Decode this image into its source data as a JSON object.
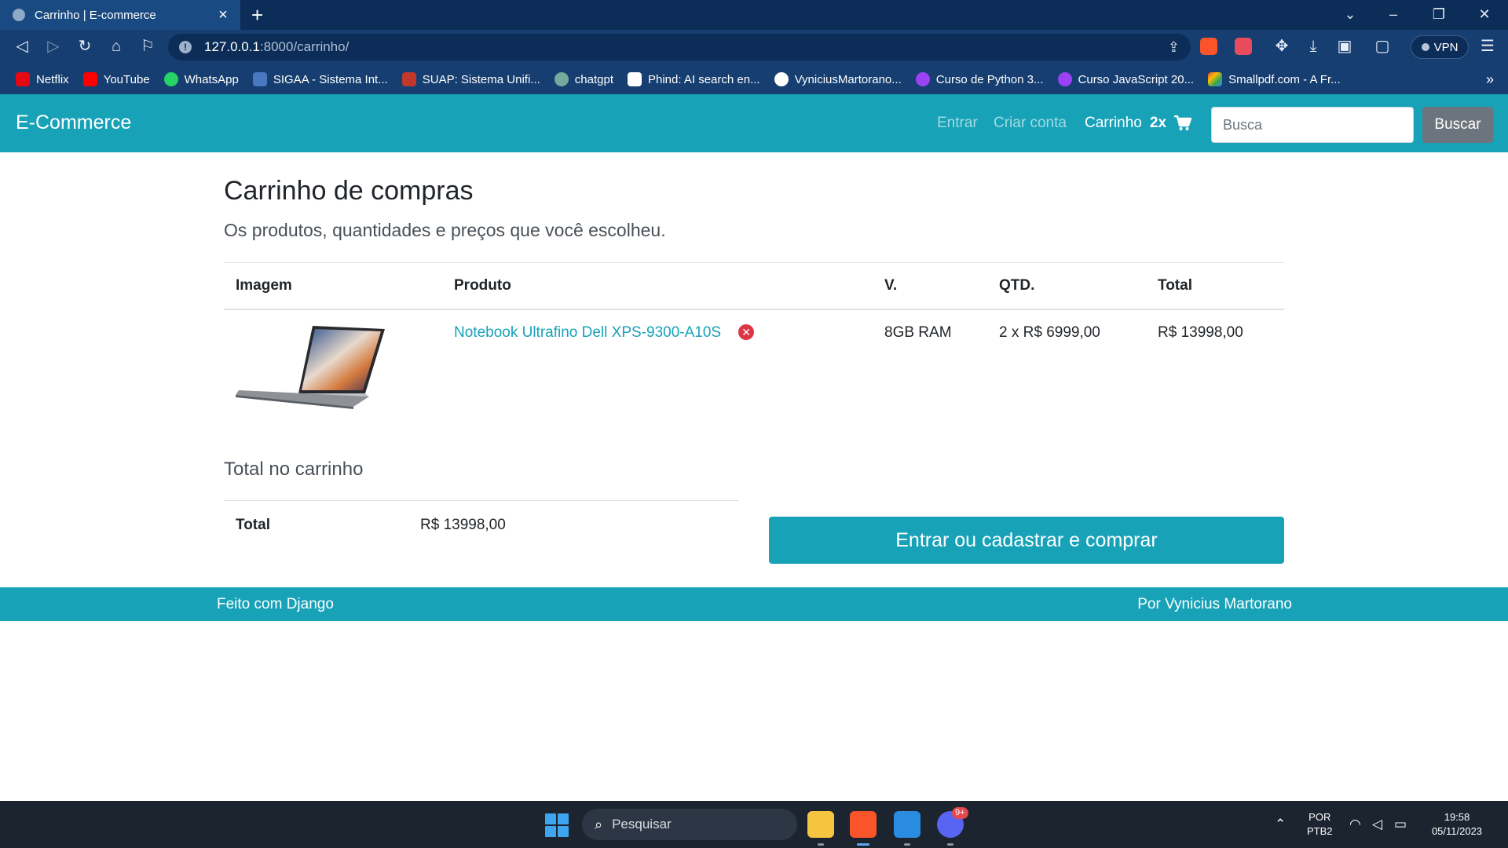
{
  "browser": {
    "tab_title": "Carrinho | E-commerce",
    "new_tab": "+",
    "url_host": "127.0.0.1",
    "url_path": ":8000/carrinho/",
    "vpn_label": "VPN",
    "bookmarks": [
      {
        "label": "Netflix",
        "color": "#e50914"
      },
      {
        "label": "YouTube",
        "color": "#ff0000"
      },
      {
        "label": "WhatsApp",
        "color": "#25d366"
      },
      {
        "label": "SIGAA - Sistema Int...",
        "color": "#4a78c2"
      },
      {
        "label": "SUAP: Sistema Unifi...",
        "color": "#c0392b"
      },
      {
        "label": "chatgpt",
        "color": "#74aa9c"
      },
      {
        "label": "Phind: AI search en...",
        "color": "#111111"
      },
      {
        "label": "VyniciusMartorano...",
        "color": "#ffffff"
      },
      {
        "label": "Curso de Python 3...",
        "color": "#9b42f5"
      },
      {
        "label": "Curso JavaScript 20...",
        "color": "#9b42f5"
      },
      {
        "label": "Smallpdf.com - A Fr...",
        "color": "#f4b400"
      }
    ],
    "more": "»"
  },
  "site": {
    "brand": "E-Commerce",
    "nav": {
      "login": "Entrar",
      "signup": "Criar conta",
      "cart_label": "Carrinho",
      "cart_count": "2x"
    },
    "search": {
      "placeholder": "Busca",
      "button": "Buscar"
    },
    "accent_color": "#17a2b8"
  },
  "cart": {
    "title": "Carrinho de compras",
    "subtitle": "Os produtos, quantidades e preços que você escolheu.",
    "headers": [
      "Imagem",
      "Produto",
      "V.",
      "QTD.",
      "Total"
    ],
    "items": [
      {
        "product": "Notebook Ultrafino Dell XPS-9300-A10S",
        "variation": "8GB RAM",
        "quantity": "2 x R$ 6999,00",
        "total": "R$ 13998,00"
      }
    ],
    "totals_title": "Total no carrinho",
    "total_label": "Total",
    "total_value": "R$ 13998,00",
    "checkout_button": "Entrar ou cadastrar e comprar"
  },
  "footer": {
    "left": "Feito com Django",
    "right": "Por Vynicius Martorano"
  },
  "taskbar": {
    "search_placeholder": "Pesquisar",
    "lang_1": "POR",
    "lang_2": "PTB2",
    "time": "19:58",
    "date": "05/11/2023",
    "discord_badge": "9+"
  }
}
